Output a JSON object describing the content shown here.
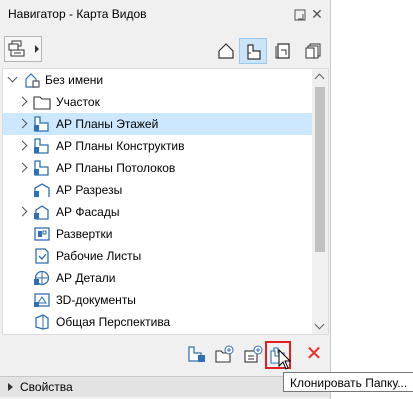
{
  "window": {
    "title": "Навигатор - Карта Видов",
    "close_glyph": "✕"
  },
  "toolbar": {
    "navigator_menu_icon": "navigator-popup-icon",
    "maps": [
      {
        "name": "project-map",
        "icon": "house-icon",
        "active": false
      },
      {
        "name": "view-map",
        "icon": "view-map-icon",
        "active": true
      },
      {
        "name": "layout-book",
        "icon": "layout-book-icon",
        "active": false
      },
      {
        "name": "publisher-sets",
        "icon": "publisher-icon",
        "active": false
      }
    ]
  },
  "tree": {
    "root": {
      "label": "Без имени",
      "icon": "view-map-root-icon",
      "expanded": true
    },
    "items": [
      {
        "label": "Участок",
        "icon": "folder-icon",
        "expandable": true,
        "selected": false
      },
      {
        "label": "АР Планы Этажей",
        "icon": "floor-plan-folder-icon",
        "expandable": true,
        "selected": true
      },
      {
        "label": "АР Планы Конструктив",
        "icon": "floor-plan-folder-icon",
        "expandable": true,
        "selected": false
      },
      {
        "label": "АР Планы Потолоков",
        "icon": "floor-plan-folder-icon",
        "expandable": true,
        "selected": false
      },
      {
        "label": "АР Разрезы",
        "icon": "section-folder-icon",
        "expandable": false,
        "selected": false
      },
      {
        "label": "АР Фасады",
        "icon": "elevation-folder-icon",
        "expandable": true,
        "selected": false
      },
      {
        "label": "Развертки",
        "icon": "interior-elevation-icon",
        "expandable": false,
        "selected": false
      },
      {
        "label": "Рабочие Листы",
        "icon": "worksheet-icon",
        "expandable": false,
        "selected": false
      },
      {
        "label": "АР Детали",
        "icon": "detail-icon",
        "expandable": false,
        "selected": false
      },
      {
        "label": "3D-документы",
        "icon": "3d-document-icon",
        "expandable": false,
        "selected": false
      },
      {
        "label": "Общая Перспектива",
        "icon": "perspective-icon",
        "expandable": false,
        "selected": false
      }
    ]
  },
  "bottombar": {
    "buttons": [
      {
        "name": "save-view",
        "icon": "save-view-icon"
      },
      {
        "name": "new-folder",
        "icon": "new-folder-icon"
      },
      {
        "name": "new-folder-from",
        "icon": "new-subset-icon"
      },
      {
        "name": "clone-folder",
        "icon": "clone-folder-icon"
      },
      {
        "name": "delete",
        "icon": "delete-icon",
        "glyph": "✕"
      }
    ],
    "highlight_color": "#e02020"
  },
  "properties": {
    "label": "Свойства"
  },
  "tooltip": {
    "text": "Клонировать Папку..."
  },
  "colors": {
    "selection": "#cce8ff",
    "active_tool": "#cce4f7",
    "delete": "#e8302a"
  }
}
